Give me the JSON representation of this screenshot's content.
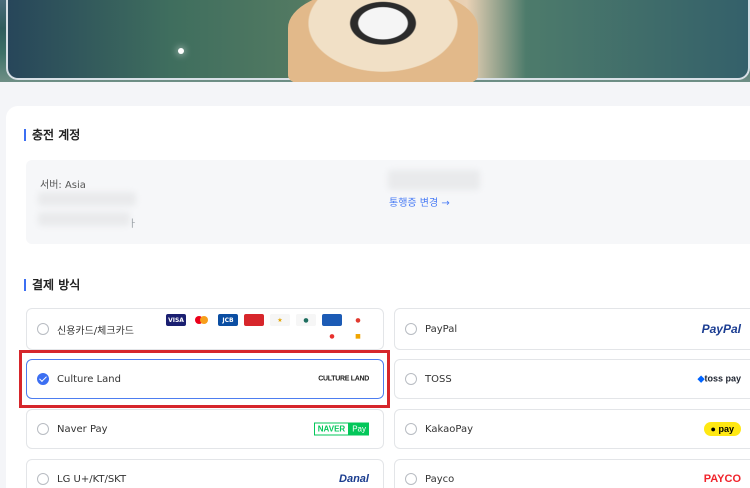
{
  "banner": {
    "alt": "game banner"
  },
  "account": {
    "section_title": "충전 계정",
    "server_label": "서버:",
    "server_value": "Asia",
    "masked_suffix": "ㅏ",
    "change_link": "통행증 변경 →"
  },
  "payment": {
    "section_title": "결제 방식",
    "methods": [
      {
        "label": "신용카드/체크카드",
        "selected": false
      },
      {
        "label": "PayPal",
        "selected": false,
        "logo": "PayPal"
      },
      {
        "label": "Culture Land",
        "selected": true,
        "logo": "CULTURE LAND"
      },
      {
        "label": "TOSS",
        "selected": false,
        "logo": "toss pay"
      },
      {
        "label": "Naver Pay",
        "selected": false,
        "logo_left": "NAVER",
        "logo_right": "Pay"
      },
      {
        "label": "KakaoPay",
        "selected": false,
        "logo": "pay"
      },
      {
        "label": "LG U+/KT/SKT",
        "selected": false,
        "logo": "Danal"
      },
      {
        "label": "Payco",
        "selected": false,
        "logo": "PAYCO"
      }
    ],
    "card_brands": [
      "VISA",
      "mastercard",
      "JCB",
      "UnionPay"
    ]
  },
  "colors": {
    "accent": "#3c6ff2",
    "highlight": "#d6262b"
  }
}
